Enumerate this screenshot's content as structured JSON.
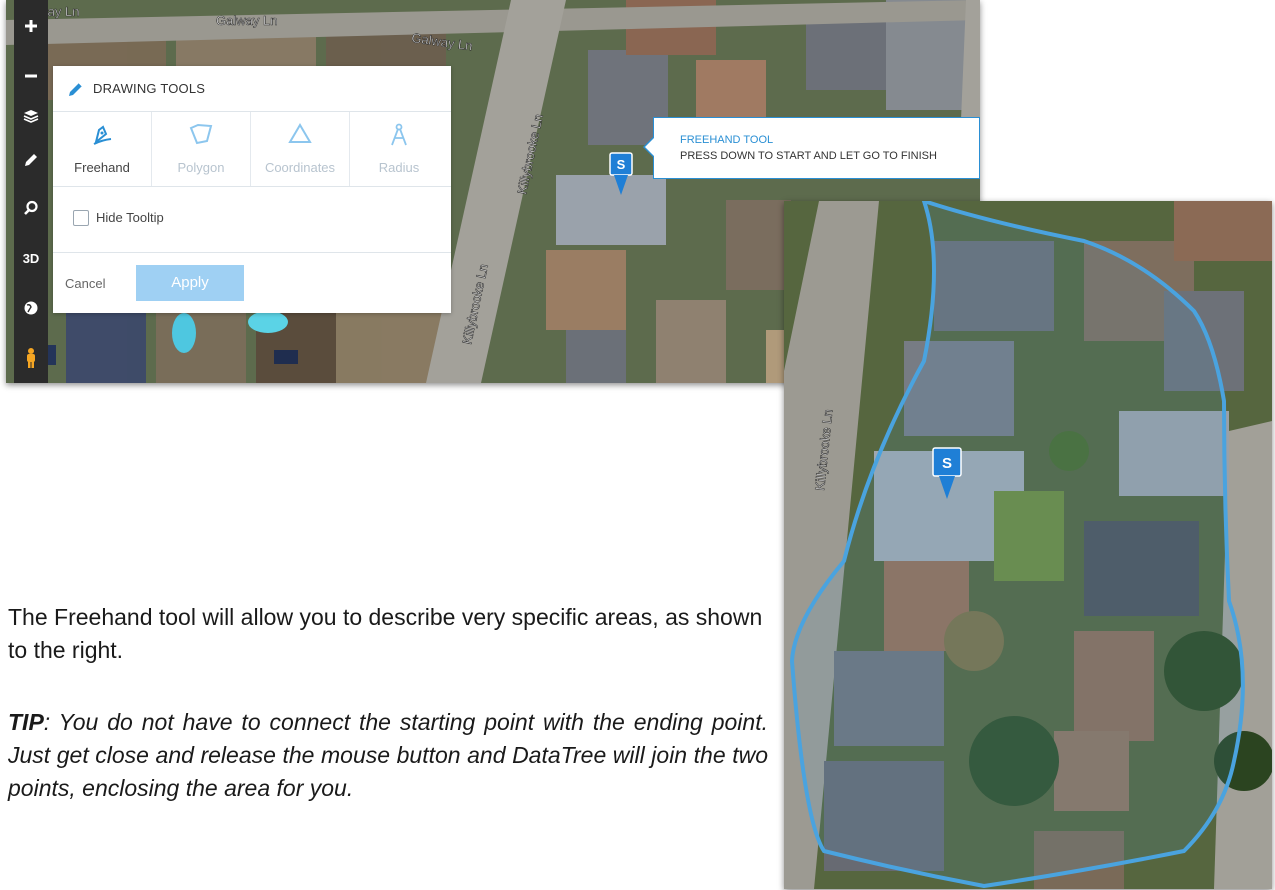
{
  "map_streets": {
    "top_left": "Galway Ln",
    "top_center": "Galway Ln",
    "top_right": "Galway Ln",
    "vertical_upper": "Killybrooke Ln",
    "vertical_lower": "Killybrooke Ln",
    "right_map_vertical": "Killybrooke Ln"
  },
  "toolbar": {
    "items": [
      {
        "icon": "zoom-in-icon"
      },
      {
        "icon": "zoom-out-icon"
      },
      {
        "icon": "layers-icon"
      },
      {
        "icon": "pencil-icon"
      },
      {
        "icon": "search-icon"
      },
      {
        "label": "3D"
      },
      {
        "icon": "globe-icon"
      },
      {
        "icon": "pegman-icon"
      }
    ]
  },
  "drawing_tools": {
    "title": "DRAWING TOOLS",
    "tools": [
      {
        "label": "Freehand",
        "icon": "freehand-pen-icon",
        "state": "active"
      },
      {
        "label": "Polygon",
        "icon": "polygon-icon",
        "state": "disabled"
      },
      {
        "label": "Coordinates",
        "icon": "coordinates-icon",
        "state": "disabled"
      },
      {
        "label": "Radius",
        "icon": "radius-compass-icon",
        "state": "disabled"
      }
    ],
    "hide_tooltip_label": "Hide Tooltip",
    "hide_tooltip_checked": false,
    "cancel_label": "Cancel",
    "apply_label": "Apply"
  },
  "tooltip": {
    "title": "FREEHAND TOOL",
    "text": "PRESS DOWN TO START AND LET GO TO FINISH"
  },
  "marker_label": "S",
  "body": {
    "paragraph1": "The Freehand tool will allow you to describe very specific areas, as shown to the right.",
    "tip_lead": "TIP",
    "tip_text": ": You do not have to connect the starting point with the ending point. Just get close and release the mouse button and DataTree will join the two points, enclosing the area for you."
  },
  "colors": {
    "accent_blue": "#2a8fd4",
    "apply_button": "#9fd0f3",
    "toolbar_bg": "#2b2b2b",
    "drawn_outline": "#4aa3df"
  }
}
